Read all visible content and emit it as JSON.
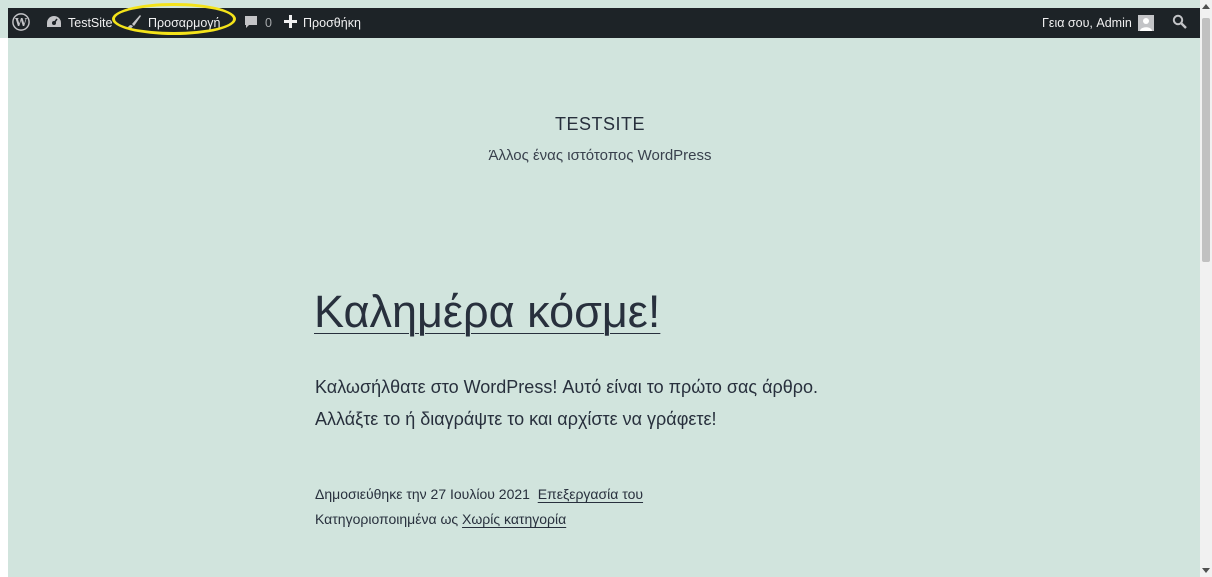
{
  "adminbar": {
    "wp_logo_icon": "wordpress-logo-icon",
    "site_name": "TestSite",
    "customize": "Προσαρμογή",
    "comments_count": "0",
    "new_content": "Προσθήκη",
    "greeting": "Γεια σου, Admin",
    "highlight_color": "#f4e31a"
  },
  "site": {
    "title": "TESTSITE",
    "description": "Άλλος ένας ιστότοπος WordPress"
  },
  "post": {
    "title": "Καλημέρα κόσμε!",
    "paragraph_line1": "Καλωσήλθατε στο WordPress! Αυτό είναι το πρώτο σας άρθρο.",
    "paragraph_line2": "Αλλάξτε το ή διαγράψτε το και αρχίστε να γράφετε!",
    "published_text": "Δημοσιεύθηκε την 27 Ιουλίου 2021",
    "edit_link": "Επεξεργασία του",
    "categorized_text": "Κατηγοριοποιημένα ως",
    "category_link": "Χωρίς κατηγορία"
  },
  "colors": {
    "page_background": "#d1e4dd",
    "adminbar_background": "#1d2327",
    "text": "#28303d"
  }
}
